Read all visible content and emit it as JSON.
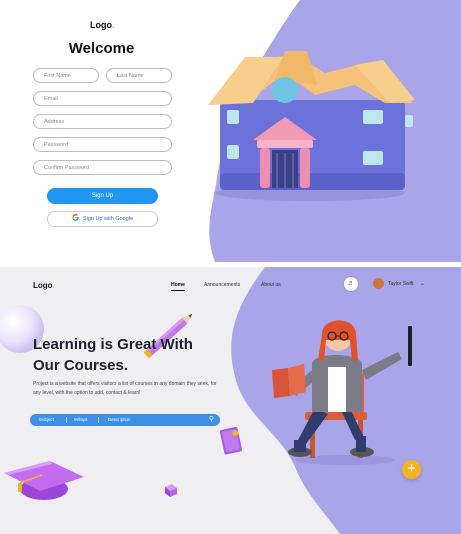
{
  "signup": {
    "logo": "Logo",
    "logo_dot": ".",
    "title": "Welcome",
    "fields": {
      "first_name": "First Name",
      "last_name": "Last Name",
      "email": "Email",
      "address": "Address",
      "password": "Password",
      "confirm_password": "Confirm Password"
    },
    "signup_button": "Sign Up",
    "google_button": "Sign Up with Google",
    "illustration": "house-illustration"
  },
  "landing": {
    "logo": "Logo",
    "logo_dot": ".",
    "nav": {
      "home": "Home",
      "announcements": "Announcements",
      "about": "About us"
    },
    "user_name": "Taylor Swift",
    "headline_line1": "Learning is Great With",
    "headline_line2": "Our Courses.",
    "description": "Project is a website that offers visitors a list of courses in any domain they seek, for any level, with the option to add, contact & learn!",
    "search": {
      "subject": "Subject",
      "wilaya": "Wilaya",
      "description": "Description"
    },
    "plus_label": "+",
    "icons": [
      "bell-icon",
      "chevron-down-icon",
      "search-icon",
      "plus-icon",
      "google-icon"
    ]
  },
  "colors": {
    "accent_blue": "#2196f3",
    "lavender": "#a9a3e6",
    "orange": "#f4b323"
  }
}
